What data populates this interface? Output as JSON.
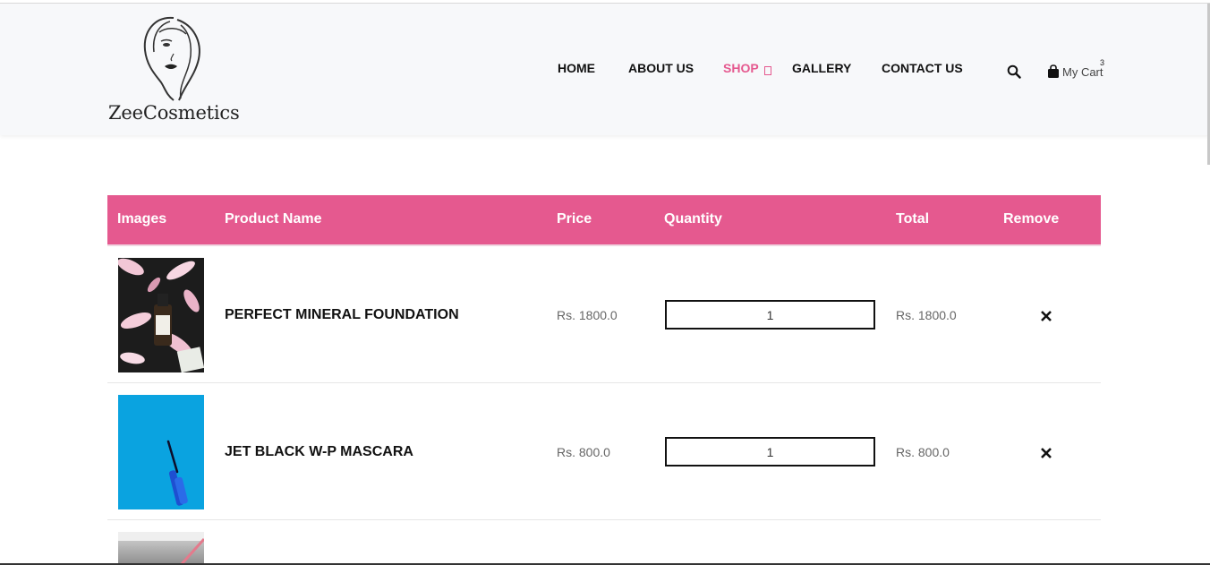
{
  "brand": {
    "name": "ZeeCosmetics"
  },
  "nav": {
    "items": [
      {
        "label": "HOME",
        "active": false
      },
      {
        "label": "ABOUT US",
        "active": false
      },
      {
        "label": "SHOP",
        "active": true
      },
      {
        "label": "GALLERY",
        "active": false
      },
      {
        "label": "CONTACT US",
        "active": false
      }
    ],
    "search_icon": "search-icon",
    "cart": {
      "label": "My Cart",
      "count": "3",
      "icon": "shopping-bag-icon"
    }
  },
  "colors": {
    "accent": "#e5598f",
    "header_bg": "#f7f8fa"
  },
  "cart_table": {
    "headers": [
      "Images",
      "Product Name",
      "Price",
      "Quantity",
      "Total",
      "Remove"
    ],
    "rows": [
      {
        "name": "PERFECT MINERAL FOUNDATION",
        "price": "Rs. 1800.0",
        "quantity": "1",
        "total": "Rs. 1800.0",
        "image": "foundation-bottle-with-pink-petals"
      },
      {
        "name": "JET BLACK W-P MASCARA",
        "price": "Rs. 800.0",
        "quantity": "1",
        "total": "Rs. 800.0",
        "image": "mascara-wand-on-blue-background"
      },
      {
        "name": "",
        "price": "",
        "quantity": "",
        "total": "",
        "image": "partially-visible-product-image"
      }
    ]
  }
}
